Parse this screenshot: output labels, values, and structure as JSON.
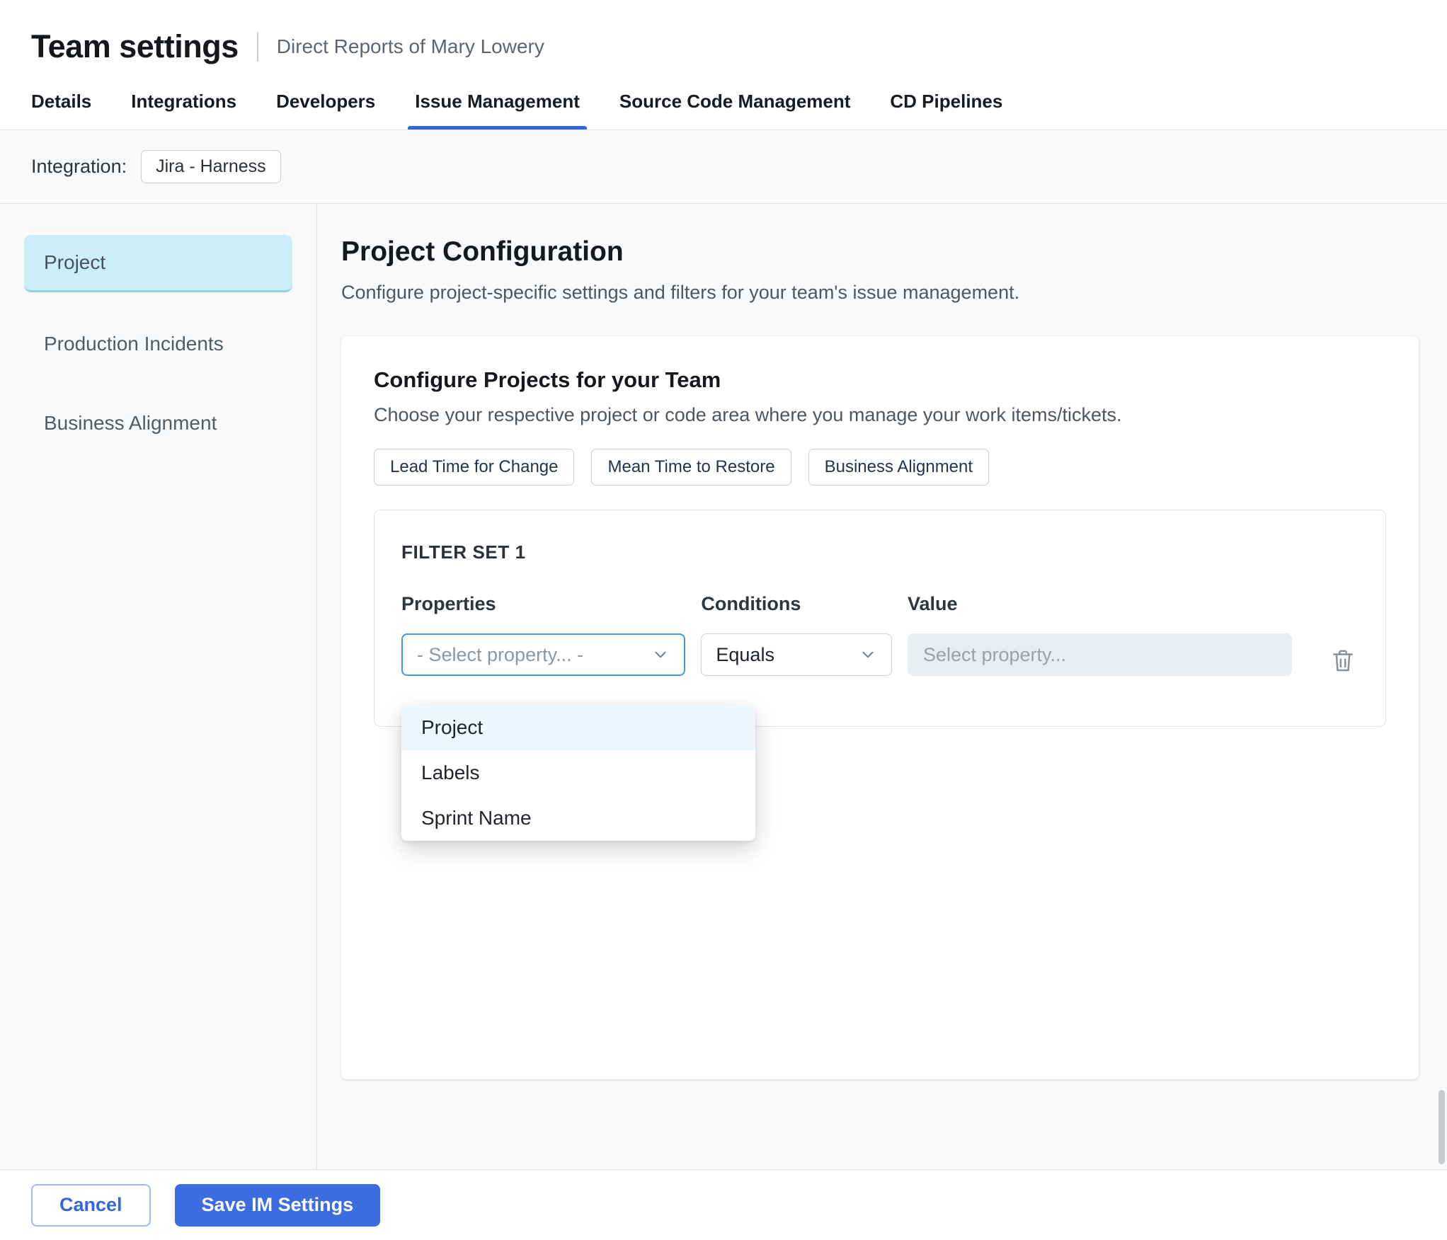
{
  "header": {
    "title": "Team settings",
    "subtitle": "Direct Reports of Mary Lowery"
  },
  "tabs": [
    {
      "label": "Details",
      "active": false
    },
    {
      "label": "Integrations",
      "active": false
    },
    {
      "label": "Developers",
      "active": false
    },
    {
      "label": "Issue Management",
      "active": true
    },
    {
      "label": "Source Code Management",
      "active": false
    },
    {
      "label": "CD Pipelines",
      "active": false
    }
  ],
  "integration": {
    "label": "Integration:",
    "value": "Jira - Harness"
  },
  "sidebar": {
    "items": [
      {
        "label": "Project",
        "active": true
      },
      {
        "label": "Production Incidents",
        "active": false
      },
      {
        "label": "Business Alignment",
        "active": false
      }
    ]
  },
  "main": {
    "title": "Project Configuration",
    "subtitle": "Configure project-specific settings and filters for your team's issue management.",
    "card": {
      "title": "Configure Projects for your Team",
      "subtitle": "Choose your respective project or code area where you manage your work items/tickets.",
      "chips": [
        "Lead Time for Change",
        "Mean Time to Restore",
        "Business Alignment"
      ],
      "filter_set": {
        "title": "FILTER SET 1",
        "columns": {
          "properties": "Properties",
          "conditions": "Conditions",
          "value": "Value"
        },
        "property_select": {
          "placeholder": "- Select property... -"
        },
        "condition_select": {
          "value": "Equals"
        },
        "value_input": {
          "placeholder": "Select property..."
        },
        "dropdown_options": [
          {
            "label": "Project",
            "highlighted": true
          },
          {
            "label": "Labels",
            "highlighted": false
          },
          {
            "label": "Sprint Name",
            "highlighted": false
          }
        ]
      }
    }
  },
  "footer": {
    "cancel_label": "Cancel",
    "save_label": "Save IM Settings"
  },
  "icons": {
    "chevron_down": "chevron-down",
    "trash": "trash"
  },
  "colors": {
    "accent_blue": "#3b6ce0",
    "tab_underline": "#3168d8",
    "sidebar_selected_bg": "#cdeef8",
    "select_focus_border": "#3e9bd9",
    "dropdown_highlight_bg": "#eef8fc"
  }
}
